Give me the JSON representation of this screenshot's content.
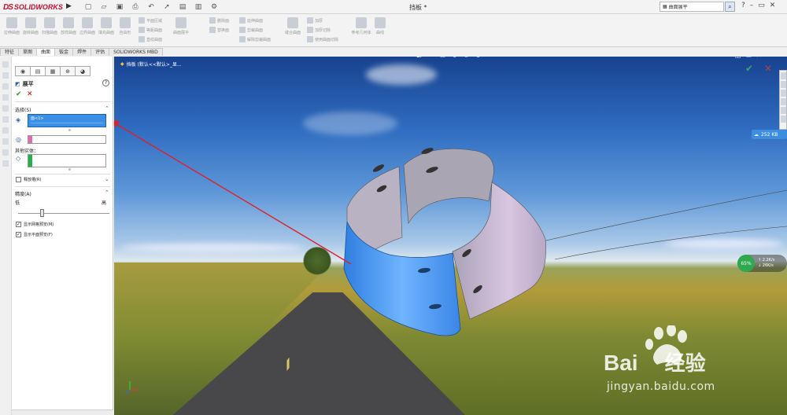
{
  "app": {
    "logo_text": "SOLIDWORKS",
    "document_title": "挡板 *",
    "search_placeholder": "曲面展平",
    "help_label": "?"
  },
  "ribbon": {
    "buttons": [
      "拉伸曲面",
      "旋转曲面",
      "扫描曲面",
      "放样曲面",
      "边界曲面",
      "填充曲面",
      "自由形"
    ],
    "small_a": [
      "平面区域",
      "等距曲面",
      "直纹曲面"
    ],
    "mid_button": "曲面展平",
    "small_b": [
      "删除面",
      "替换面"
    ],
    "small_c": [
      "延伸曲面",
      "剪裁曲面",
      "解除剪裁曲面"
    ],
    "knit_button": "缝合曲面",
    "small_d": [
      "加厚",
      "加厚切除",
      "使用曲面切除"
    ],
    "ref_button": "参考几何体",
    "curve_button": "曲线"
  },
  "tabs": [
    "特征",
    "草图",
    "曲面",
    "钣金",
    "焊件",
    "评估",
    "SOLIDWORKS MBD"
  ],
  "active_tab": "曲面",
  "pm": {
    "title": "展平",
    "section_selection": "选择(S)",
    "selection_value": "面<1>",
    "other_entities": "其他实体：",
    "section_relief": "释放槽(R)",
    "section_accuracy": "精度(A)",
    "low": "低",
    "high": "高",
    "accuracy_level": 0.25,
    "show_mesh": "显示网格预览(M)",
    "show_flat": "显示平面预览(F)"
  },
  "viewport": {
    "breadcrumb": "挡板 (默认<<默认>_显...",
    "upload_rate": "252 KB",
    "net_percent": "65%",
    "rate_up": "2.2K/s",
    "rate_down": "26K/s"
  },
  "watermark": {
    "brand": "Bai",
    "brand_cn": "经验",
    "url": "jingyan.baidu.com"
  },
  "colors": {
    "selection_blue": "#3b8fe6",
    "part_blue": "#4a9cf0",
    "part_pink": "#cfc0d8",
    "arrow_red": "#e0202a"
  }
}
